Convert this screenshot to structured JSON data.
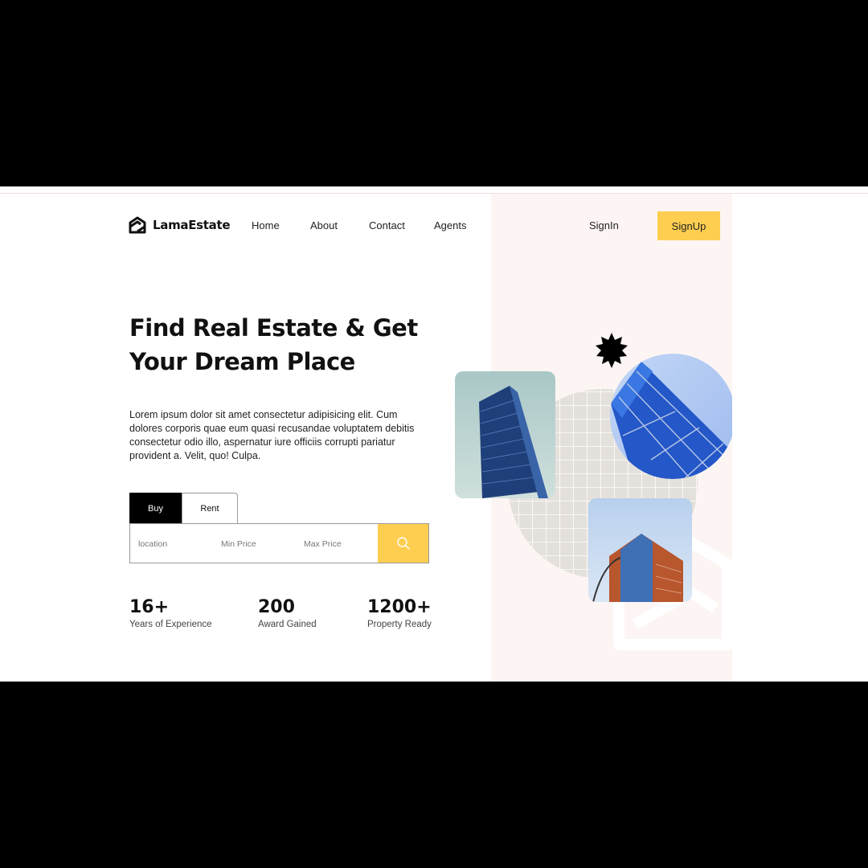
{
  "brand": {
    "name": "LamaEstate"
  },
  "nav": {
    "items": [
      "Home",
      "About",
      "Contact",
      "Agents"
    ],
    "signin": "SignIn",
    "signup": "SignUp"
  },
  "hero": {
    "title": "Find Real Estate & Get Your Dream Place",
    "description": "Lorem ipsum dolor sit amet consectetur adipisicing elit. Cum dolores corporis quae eum quasi recusandae voluptatem debitis consectetur odio illo, aspernatur iure officiis corrupti pariatur provident a. Velit, quo! Culpa."
  },
  "search": {
    "tabs": [
      "Buy",
      "Rent"
    ],
    "active_tab": "Buy",
    "location_placeholder": "location",
    "min_price_placeholder": "Min Price",
    "max_price_placeholder": "Max Price",
    "button_icon": "search-icon"
  },
  "stats": [
    {
      "value": "16+",
      "label": "Years of Experience"
    },
    {
      "value": "200",
      "label": "Award Gained"
    },
    {
      "value": "1200+",
      "label": "Property Ready"
    }
  ],
  "colors": {
    "accent": "#fece51",
    "panel": "#fcf5f3",
    "dark": "#000000"
  }
}
